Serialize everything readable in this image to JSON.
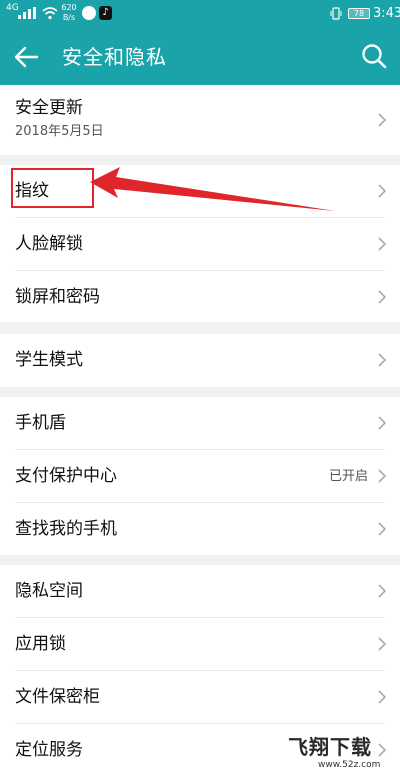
{
  "status_bar": {
    "signal_type": "4G",
    "network_speed": "620 B/s",
    "battery_level": "78",
    "time": "3:43"
  },
  "app_bar": {
    "title": "安全和隐私",
    "back_icon": "arrow-left-icon",
    "search_icon": "search-icon"
  },
  "sections": [
    {
      "items": [
        {
          "label": "安全更新",
          "subtitle": "2018年5月5日"
        }
      ]
    },
    {
      "items": [
        {
          "label": "指纹"
        },
        {
          "label": "人脸解锁"
        },
        {
          "label": "锁屏和密码"
        }
      ]
    },
    {
      "items": [
        {
          "label": "学生模式"
        }
      ]
    },
    {
      "items": [
        {
          "label": "手机盾"
        },
        {
          "label": "支付保护中心",
          "value": "已开启"
        },
        {
          "label": "查找我的手机"
        }
      ]
    },
    {
      "items": [
        {
          "label": "隐私空间"
        },
        {
          "label": "应用锁"
        },
        {
          "label": "文件保密柜"
        },
        {
          "label": "定位服务"
        }
      ]
    }
  ],
  "annotation": {
    "highlight_color": "#e0262a",
    "highlighted_item": "指纹"
  },
  "watermark": {
    "logo": "飞翔下载",
    "url": "www.52z.com"
  },
  "colors": {
    "primary": "#1aa3a8",
    "background": "#f2f2f2",
    "surface": "#ffffff"
  }
}
